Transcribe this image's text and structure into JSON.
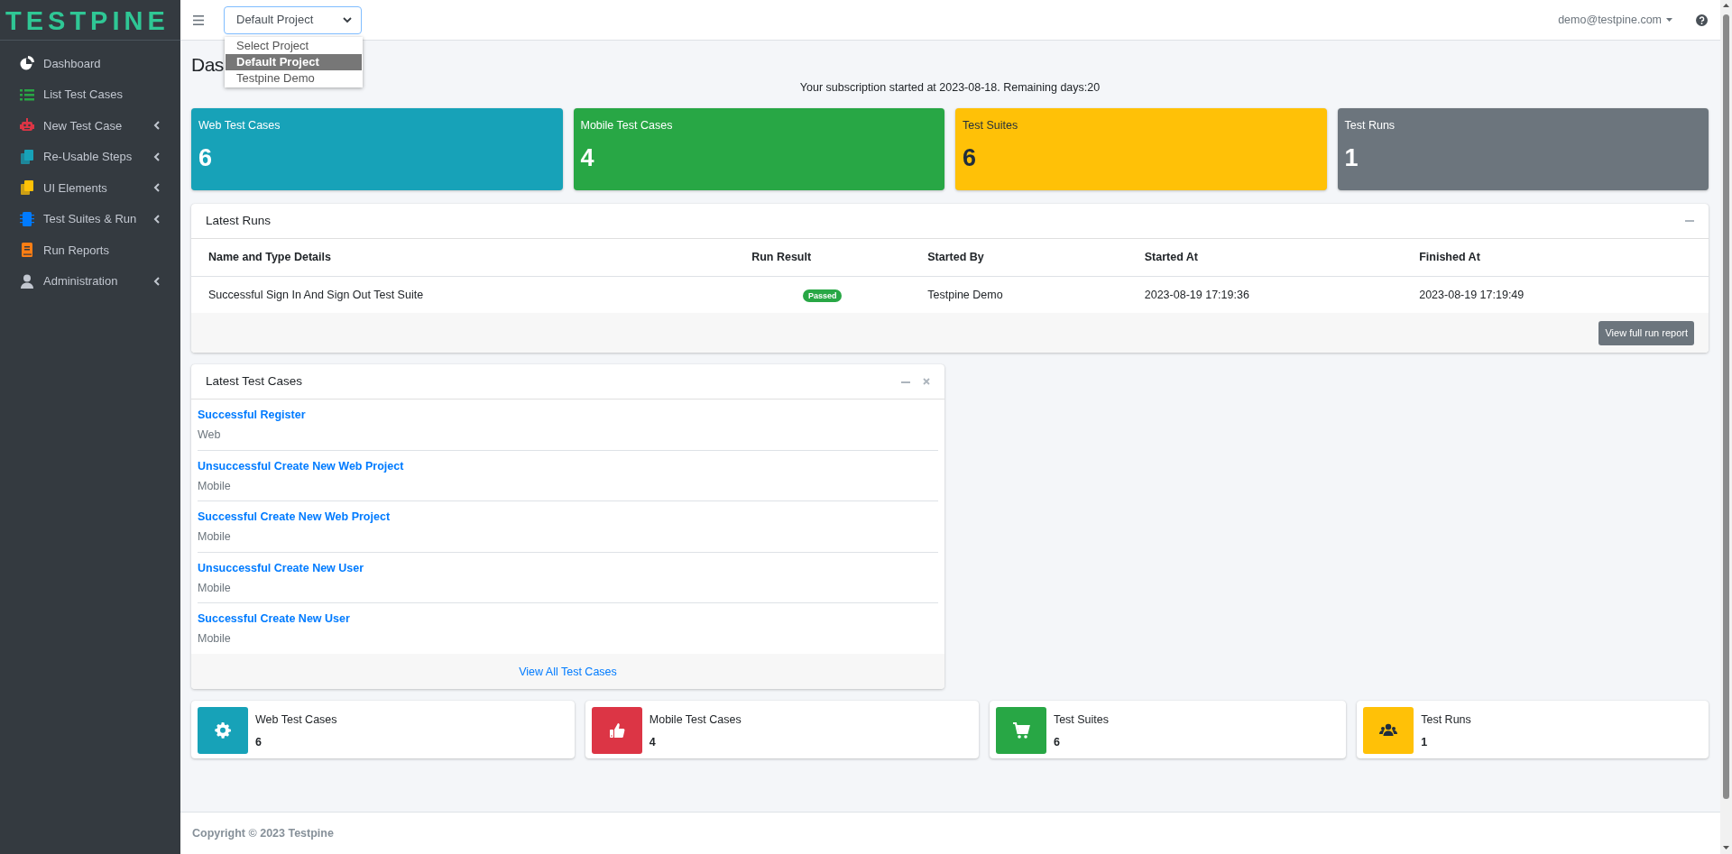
{
  "brand": {
    "logo": "TESTPINE"
  },
  "sidebar": {
    "items": [
      {
        "label": "Dashboard",
        "color": "#ffffff",
        "expandable": false
      },
      {
        "label": "List Test Cases",
        "color": "#28a745",
        "expandable": false
      },
      {
        "label": "New Test Case",
        "color": "#dc3545",
        "expandable": true
      },
      {
        "label": "Re-Usable Steps",
        "color": "#17a2b8",
        "expandable": true
      },
      {
        "label": "UI Elements",
        "color": "#ffc107",
        "expandable": true
      },
      {
        "label": "Test Suites & Run",
        "color": "#007bff",
        "expandable": true
      },
      {
        "label": "Run Reports",
        "color": "#fd7e14",
        "expandable": false
      },
      {
        "label": "Administration",
        "color": "#c2c7d0",
        "expandable": true
      }
    ]
  },
  "topbar": {
    "project_select": {
      "value": "Default Project",
      "options": [
        {
          "label": "Select Project",
          "selected": false
        },
        {
          "label": "Default Project",
          "selected": true
        },
        {
          "label": "Testpine Demo",
          "selected": false
        }
      ]
    },
    "user": "demo@testpine.com"
  },
  "page_title": "Das",
  "subscription": "Your subscription started at 2023-08-18. Remaining days:20",
  "stat_boxes": [
    {
      "label": "Web Test Cases",
      "value": "6",
      "color": "#17a2b8"
    },
    {
      "label": "Mobile Test Cases",
      "value": "4",
      "color": "#28a745"
    },
    {
      "label": "Test Suites",
      "value": "6",
      "color": "#ffc107"
    },
    {
      "label": "Test Runs",
      "value": "1",
      "color": "#6c757d"
    }
  ],
  "latest_runs": {
    "title": "Latest Runs",
    "columns": [
      "Name and Type Details",
      "Run Result",
      "Started By",
      "Started At",
      "Finished At"
    ],
    "rows": [
      {
        "name": "Successful Sign In And Sign Out Test Suite",
        "result": "Passed",
        "started_by": "Testpine Demo",
        "started_at": "2023-08-19 17:19:36",
        "finished_at": "2023-08-19 17:19:49"
      }
    ],
    "button": "View full run report"
  },
  "latest_test_cases": {
    "title": "Latest Test Cases",
    "items": [
      {
        "name": "Successful Register",
        "type": "Web"
      },
      {
        "name": "Unsuccessful Create New Web Project",
        "type": "Mobile"
      },
      {
        "name": "Successful Create New Web Project",
        "type": "Mobile"
      },
      {
        "name": "Unsuccessful Create New User",
        "type": "Mobile"
      },
      {
        "name": "Successful Create New User",
        "type": "Mobile"
      }
    ],
    "footer_link": "View All Test Cases"
  },
  "info_boxes": [
    {
      "label": "Web Test Cases",
      "value": "6",
      "color": "#17a2b8"
    },
    {
      "label": "Mobile Test Cases",
      "value": "4",
      "color": "#dc3545"
    },
    {
      "label": "Test Suites",
      "value": "6",
      "color": "#28a745"
    },
    {
      "label": "Test Runs",
      "value": "1",
      "color": "#ffc107"
    }
  ],
  "footer": "Copyright © 2023 Testpine"
}
